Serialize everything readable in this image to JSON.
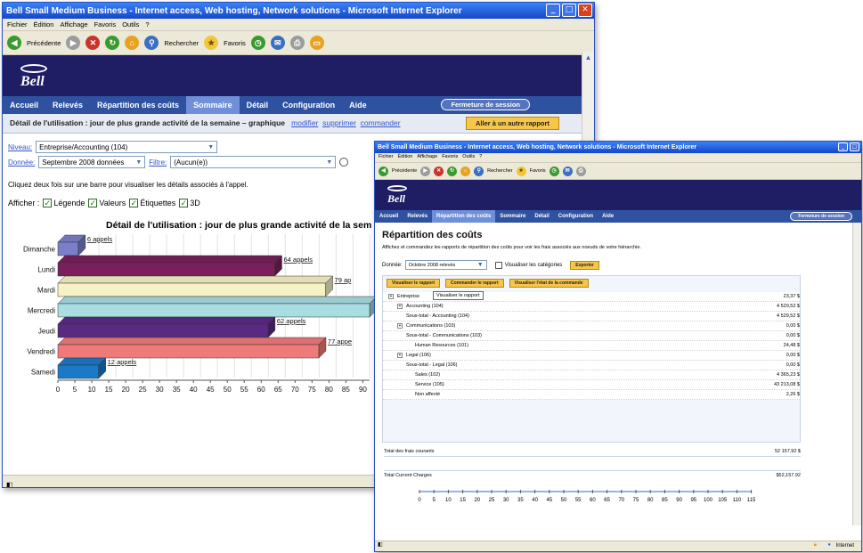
{
  "browser": {
    "window_title": "Bell Small Medium Business - Internet access, Web hosting, Network solutions - Microsoft Internet Explorer",
    "menu": [
      "Fichier",
      "Édition",
      "Affichage",
      "Favoris",
      "Outils",
      "?"
    ],
    "back_label": "Précédente",
    "search_label": "Rechercher",
    "favorites_label": "Favoris",
    "status_zone": "Internet"
  },
  "app": {
    "logo": "Bell",
    "tabs_w1": [
      "Accueil",
      "Relevés",
      "Répartition des coûts",
      "Sommaire",
      "Détail",
      "Configuration",
      "Aide"
    ],
    "tabs_w2": [
      "Accueil",
      "Relevés",
      "Répartition des coûts",
      "Sommaire",
      "Détail",
      "Configuration",
      "Aide"
    ],
    "logout": "Fermeture de session"
  },
  "w1": {
    "detail_title": "Détail de l'utilisation : jour de plus grande activité de la semaine – graphique",
    "link_modify": "modifier",
    "link_delete": "supprimer",
    "link_order": "commander",
    "goto_report": "Aller à un autre rapport",
    "level_label": "Niveau:",
    "level_value": "Entreprise/Accounting (104)",
    "data_label": "Donnée:",
    "data_value": "Septembre 2008 données",
    "filter_label": "Filtre:",
    "filter_value": "(Aucun(e))",
    "instruction": "Cliquez deux fois sur une barre pour visualiser les détails associés à l'appel.",
    "show_label": "Afficher :",
    "checkboxes": [
      "Légende",
      "Valeurs",
      "Étiquettes",
      "3D"
    ],
    "chart_title": "Détail de l'utilisation : jour de plus grande activité de la sem"
  },
  "chart_data": {
    "type": "bar",
    "orientation": "horizontal",
    "title": "Détail de l'utilisation : jour de plus grande activité de la sem",
    "categories": [
      "Dimanche",
      "Lundi",
      "Mardi",
      "Mercredi",
      "Jeudi",
      "Vendredi",
      "Samedi"
    ],
    "values": [
      6,
      64,
      79,
      100,
      62,
      77,
      12
    ],
    "data_labels": [
      "6 appels",
      "64 appels",
      "79 ap",
      "",
      "62 appels",
      "77 appe",
      "12 appels"
    ],
    "colors": [
      "#7b7fc9",
      "#7a1f5c",
      "#f7f1c6",
      "#a8dde2",
      "#5a2a83",
      "#f07a7a",
      "#1a7ac8"
    ],
    "xticks": [
      0,
      5,
      10,
      15,
      20,
      25,
      30,
      35,
      40,
      45,
      50,
      55,
      60,
      65,
      70,
      75,
      80,
      85,
      90
    ],
    "xlim": [
      0,
      92
    ]
  },
  "w2": {
    "title": "Répartition des coûts",
    "description": "Affichez et commandez les rapports de répartition des coûts pour voir les frais associés aux noeuds de votre hiérarchie.",
    "data_label": "Donnée:",
    "data_value": "Octobre 2008 relevés",
    "show_categories": "Visualiser les catégories",
    "export": "Exporter",
    "buttons": [
      "Visualiser le rapport",
      "Commander le rapport",
      "Visualiser l'état de la commande"
    ],
    "tooltip": "Visualiser le rapport",
    "rows": [
      {
        "label": "Entreprise",
        "amount": "23,37 $",
        "indent": 0,
        "expand": true
      },
      {
        "label": "Accounting (104)",
        "amount": "4 529,52 $",
        "indent": 1,
        "expand": true
      },
      {
        "label": "Sous-total - Accounting (104)",
        "amount": "4 529,52 $",
        "indent": 1,
        "expand": false
      },
      {
        "label": "Communications (103)",
        "amount": "0,00 $",
        "indent": 1,
        "expand": true
      },
      {
        "label": "Sous-total - Communications (103)",
        "amount": "0,00 $",
        "indent": 1,
        "expand": false
      },
      {
        "label": "Human Resources (101)",
        "amount": "24,48 $",
        "indent": 2,
        "expand": false
      },
      {
        "label": "Legal (106)",
        "amount": "0,00 $",
        "indent": 1,
        "expand": true
      },
      {
        "label": "Sous-total - Legal (106)",
        "amount": "0,00 $",
        "indent": 1,
        "expand": false
      },
      {
        "label": "Sales (102)",
        "amount": "4 365,23 $",
        "indent": 2,
        "expand": false
      },
      {
        "label": "Service (105)",
        "amount": "43 213,08 $",
        "indent": 2,
        "expand": false
      },
      {
        "label": "Non affecté",
        "amount": "2,26 $",
        "indent": 2,
        "expand": false
      }
    ],
    "total_label": "Total des frais courants",
    "total_amount": "52 157,92 $",
    "total2_label": "Total Current Charges",
    "total2_amount": "$52,157.92",
    "axis_ticks": [
      "0",
      "5",
      "10",
      "15",
      "20",
      "25",
      "30",
      "35",
      "40",
      "45",
      "50",
      "55",
      "60",
      "65",
      "70",
      "75",
      "80",
      "85",
      "90",
      "95",
      "100",
      "105",
      "110",
      "115"
    ]
  }
}
